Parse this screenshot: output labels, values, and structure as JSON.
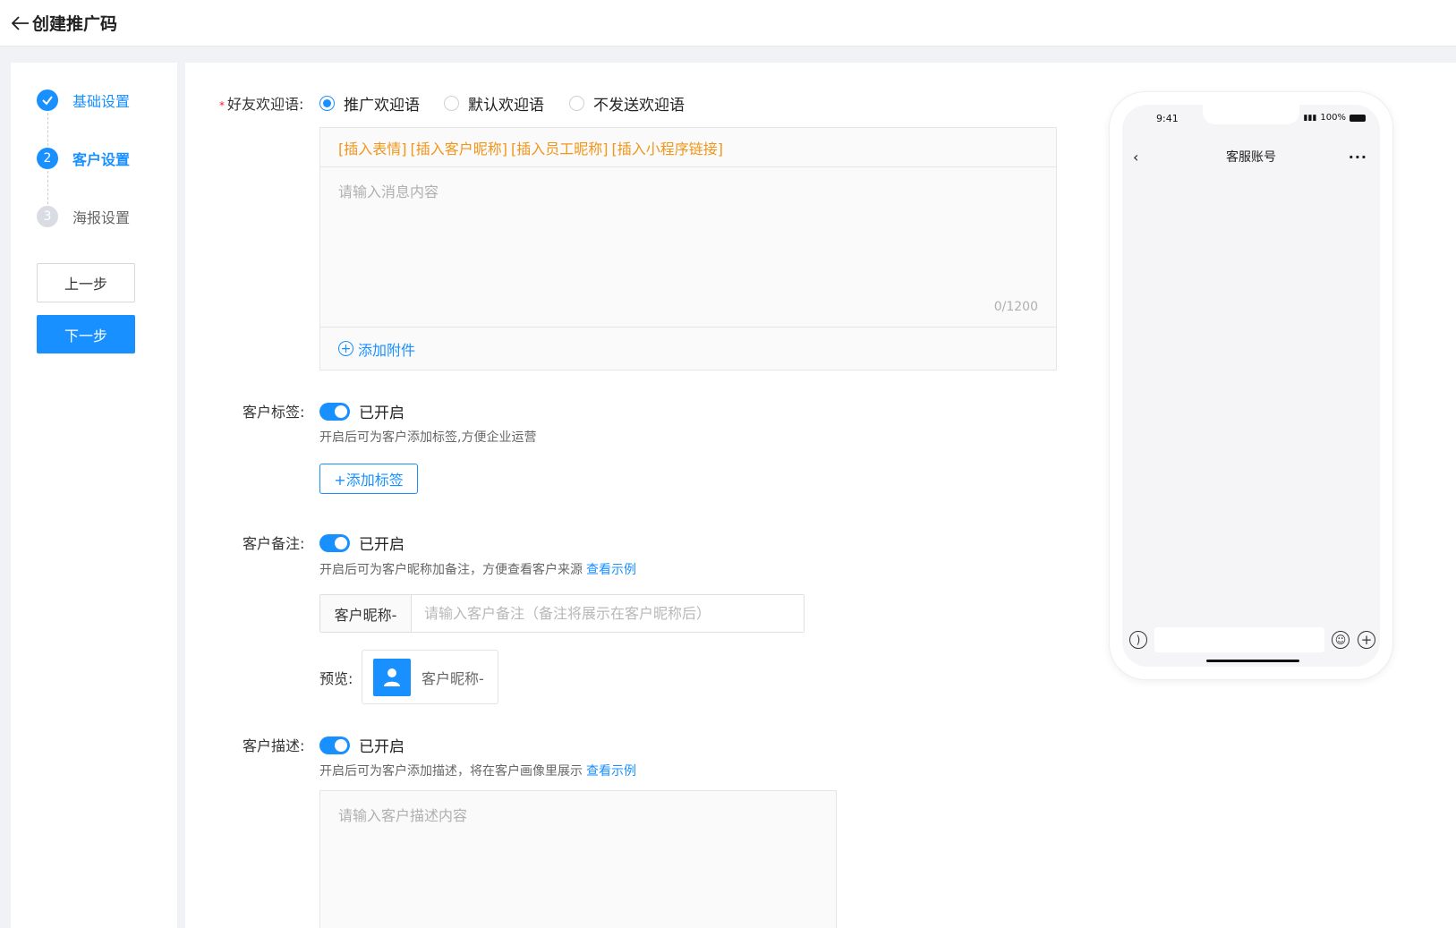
{
  "header": {
    "title": "创建推广码"
  },
  "steps": [
    {
      "index": "1",
      "label": "基础设置",
      "state": "done"
    },
    {
      "index": "2",
      "label": "客户设置",
      "state": "active"
    },
    {
      "index": "3",
      "label": "海报设置",
      "state": "todo"
    }
  ],
  "nav_buttons": {
    "prev": "上一步",
    "next": "下一步"
  },
  "welcome": {
    "label": "好友欢迎语:",
    "options": [
      "推广欢迎语",
      "默认欢迎语",
      "不发送欢迎语"
    ],
    "selected": "推广欢迎语",
    "toolbar": [
      "[插入表情]",
      "[插入客户昵称]",
      "[插入员工昵称]",
      "[插入小程序链接]"
    ],
    "placeholder": "请输入消息内容",
    "counter": "0/1200",
    "attach_label": "添加附件"
  },
  "tags": {
    "label": "客户标签:",
    "state": "已开启",
    "hint": "开启后可为客户添加标签,方便企业运营",
    "add_button": "+添加标签"
  },
  "remark": {
    "label": "客户备注:",
    "state": "已开启",
    "hint": "开启后可为客户昵称加备注，方便查看客户来源",
    "link": "查看示例",
    "prefix": "客户昵称-",
    "placeholder": "请输入客户备注（备注将展示在客户昵称后）",
    "preview_label": "预览:",
    "preview_name": "客户昵称-"
  },
  "description": {
    "label": "客户描述:",
    "state": "已开启",
    "hint": "开启后可为客户添加描述，将在客户画像里展示",
    "link": "查看示例",
    "placeholder": "请输入客户描述内容"
  },
  "phone": {
    "time": "9:41",
    "battery": "100%",
    "title": "客服账号",
    "more": "···"
  },
  "colors": {
    "primary": "#1890ff",
    "accent": "#f0961a"
  }
}
